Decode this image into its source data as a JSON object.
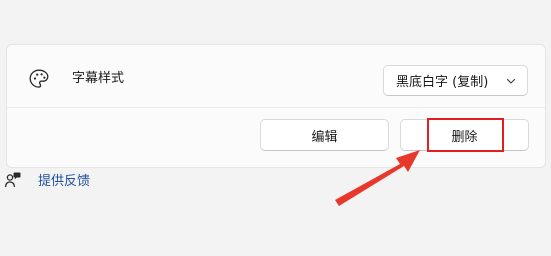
{
  "caption_setting": {
    "icon": "palette-icon",
    "label": "字幕样式",
    "dropdown_value": "黑底白字 (复制)"
  },
  "actions": {
    "edit_label": "编辑",
    "delete_label": "删除"
  },
  "feedback": {
    "icon": "feedback-icon",
    "label": "提供反馈"
  },
  "colors": {
    "highlight": "#e02020",
    "arrow": "#e8382b",
    "link": "#1f4f9b"
  }
}
